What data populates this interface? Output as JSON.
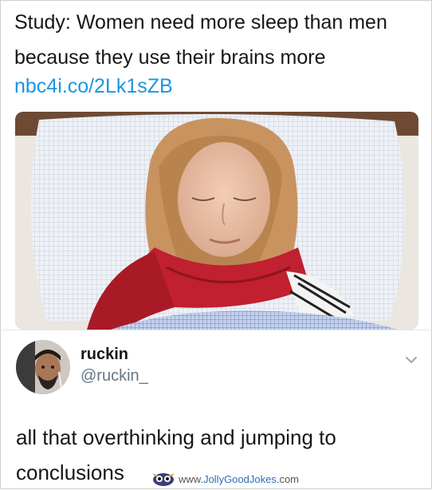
{
  "tweet": {
    "text": "Study: Women need more sleep than men because they use their brains more",
    "link": "nbc4i.co/2Lk1sZB"
  },
  "reply": {
    "name": "ruckin",
    "handle": "@ruckin_",
    "text": "all that overthinking and jumping to conclusions"
  },
  "watermark": {
    "prefix": "www.",
    "domain": "JollyGoodJokes",
    "suffix": ".com"
  },
  "icons": {
    "menu": "chevron-down-icon",
    "logo": "jolly-good-jokes-logo"
  },
  "colors": {
    "link": "#1b95e0",
    "text": "#14171a",
    "muted": "#657786",
    "scarf": "#c0202f"
  }
}
